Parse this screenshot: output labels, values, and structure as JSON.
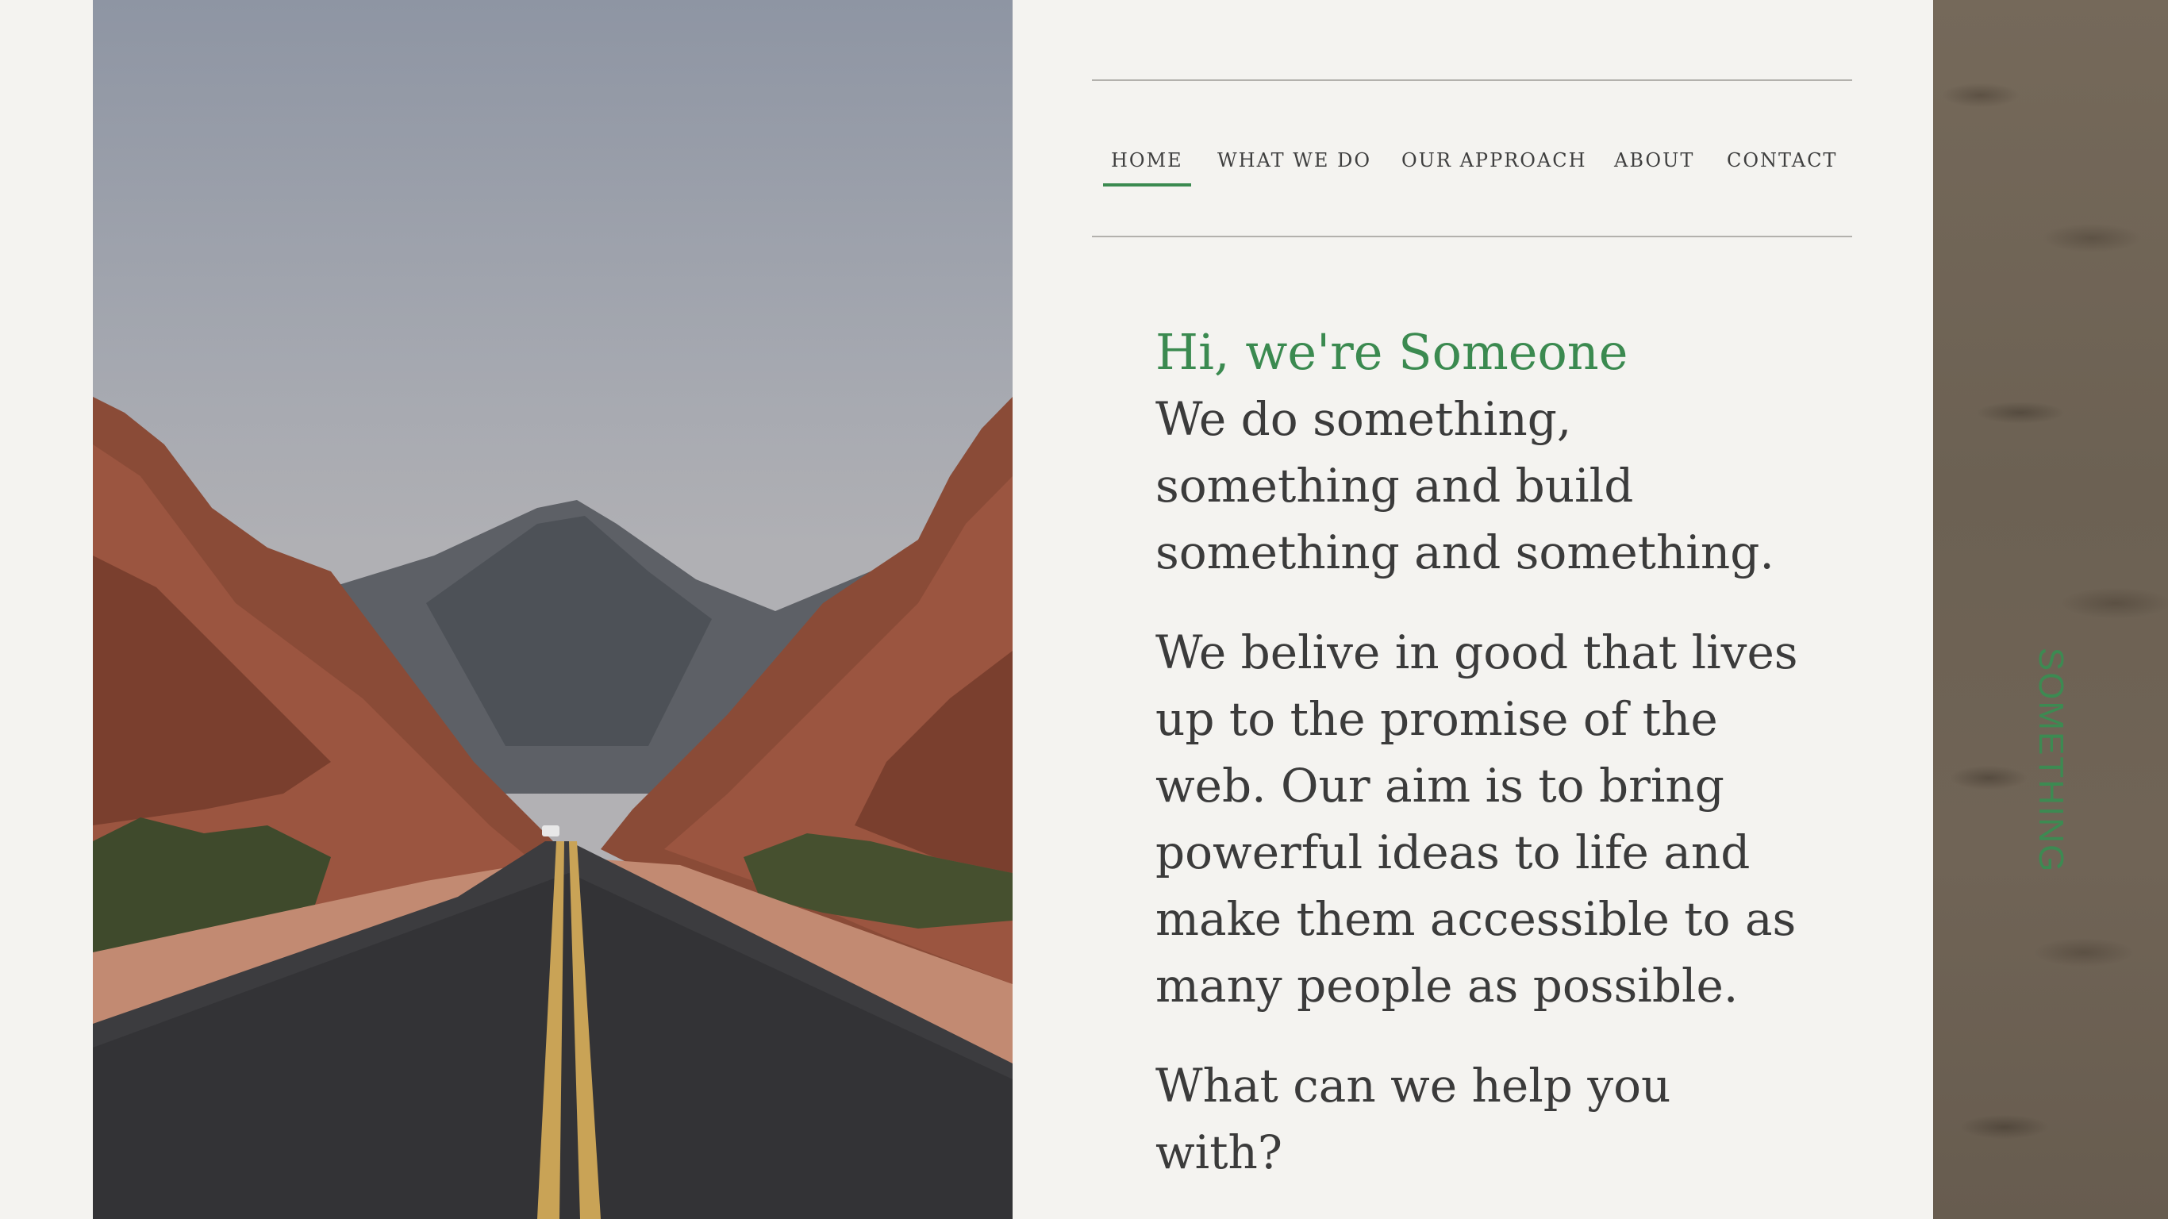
{
  "nav": {
    "items": [
      {
        "label": "HOME",
        "active": true
      },
      {
        "label": "WHAT WE DO",
        "active": false
      },
      {
        "label": "OUR APPROACH",
        "active": false
      },
      {
        "label": "ABOUT",
        "active": false
      },
      {
        "label": "CONTACT",
        "active": false
      }
    ],
    "active_color": "#3b8a50"
  },
  "hero": {
    "title": "Hi, we're Someone",
    "intro_lines": [
      "We do something,",
      "something and build",
      "something and something."
    ],
    "belief_lines": [
      "We belive in good that lives",
      "up to the promise of the",
      "web. Our aim is to bring",
      "powerful ideas to life and",
      "make them accessible to as",
      "many people as possible."
    ],
    "question_lines": [
      "What can we help you",
      "with?"
    ]
  },
  "side_strip": {
    "label": "SOMETHING"
  },
  "colors": {
    "accent": "#3b8a50",
    "background": "#f4f3f0",
    "text": "#3b3b3b"
  }
}
